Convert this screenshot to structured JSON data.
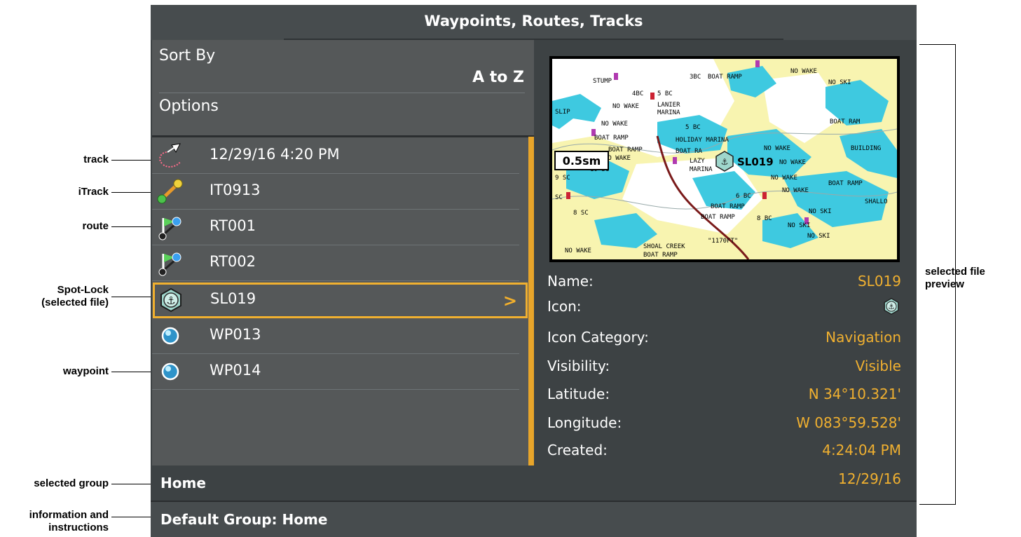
{
  "window": {
    "title": "Waypoints, Routes, Tracks"
  },
  "menu": {
    "sort_label": "Sort By",
    "sort_value": "A to Z",
    "options_label": "Options"
  },
  "items": [
    {
      "label": "12/29/16 4:20 PM",
      "icon": "track-icon",
      "selected": false
    },
    {
      "label": "IT0913",
      "icon": "itrack-icon",
      "selected": false
    },
    {
      "label": "RT001",
      "icon": "route-icon",
      "selected": false
    },
    {
      "label": "RT002",
      "icon": "route-icon",
      "selected": false
    },
    {
      "label": "SL019",
      "icon": "spot-lock-icon",
      "selected": true
    },
    {
      "label": "WP013",
      "icon": "waypoint-icon",
      "selected": false
    },
    {
      "label": "WP014",
      "icon": "waypoint-icon",
      "selected": false
    }
  ],
  "selected_chevron": ">",
  "group": {
    "label": "Home"
  },
  "footer": {
    "text": "Default Group: Home"
  },
  "preview": {
    "scale": "0.5sm",
    "marker_name": "SL019",
    "map_labels": [
      "STUMP",
      "3BC",
      "BOAT RAMP",
      "NO WAKE",
      "NO SKI",
      "4BC",
      "5 BC",
      "SLIP",
      "NO WAKE",
      "LANIER",
      "MARINA",
      "NO WAKE",
      "5 BC",
      "BOAT RAM",
      "BOAT RAMP",
      "HOLIDAY MARINA",
      "BUILDING",
      "BOAT RAMP",
      "BOAT RA",
      "NO WAKE",
      "NO WAKE",
      "10 SC",
      "LAZY",
      "NO WAKE",
      "9 SC",
      "MARINA",
      "NO WAKE",
      "BOAT RAMP",
      "SC",
      "6 BC",
      "NO WAKE",
      "SHALLO",
      "8 SC",
      "BOAT RAMP",
      "NO SKI",
      "BOAT RAMP",
      "8 BC",
      "NO SKI",
      "NO SKI",
      "\"1170FT\"",
      "NO WAKE",
      "SHOAL CREEK",
      "BOAT RAMP"
    ],
    "fields": [
      {
        "key": "Name:",
        "value": "SL019"
      },
      {
        "key": "Icon:",
        "value": ""
      },
      {
        "key": "Icon Category:",
        "value": "Navigation"
      },
      {
        "key": "Visibility:",
        "value": "Visible"
      },
      {
        "key": "Latitude:",
        "value": "N 34°10.321'"
      },
      {
        "key": "Longitude:",
        "value": "W 083°59.528'"
      },
      {
        "key": "Created:",
        "value": "4:24:04 PM"
      },
      {
        "key": "",
        "value": "12/29/16"
      }
    ]
  },
  "callouts": {
    "track": "track",
    "itrack": "iTrack",
    "route": "route",
    "spotlock_1": "Spot-Lock",
    "spotlock_2": "(selected file)",
    "waypoint": "waypoint",
    "selected_group": "selected group",
    "info_1": "information and",
    "info_2": "instructions",
    "preview_1": "selected file",
    "preview_2": "preview"
  },
  "colors": {
    "accent": "#f0b030",
    "water": "#3ec9e0",
    "land": "#f8f4b0",
    "depth": "#ffffff"
  }
}
